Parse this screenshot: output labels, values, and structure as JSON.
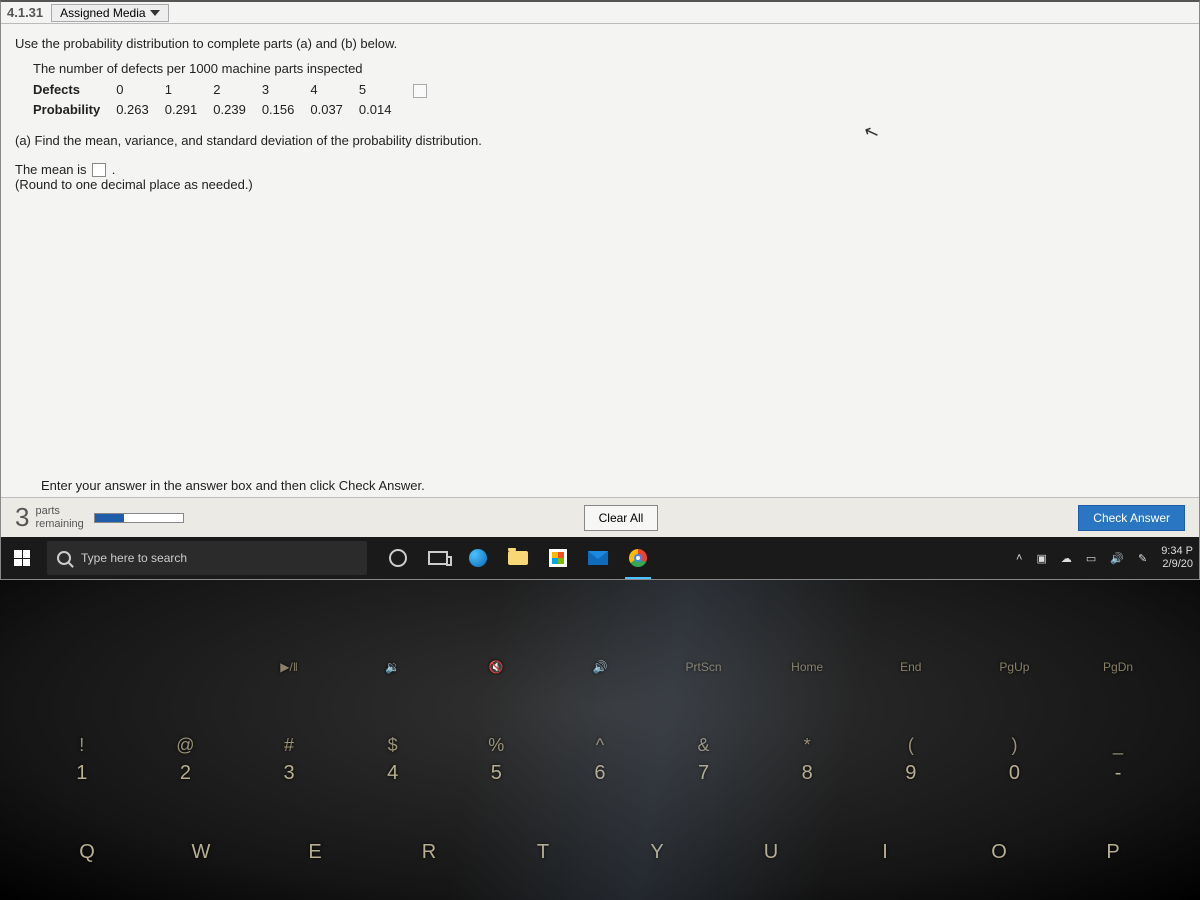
{
  "header": {
    "question_number": "4.1.31",
    "assigned_media": "Assigned Media"
  },
  "problem": {
    "prompt": "Use the probability distribution to complete parts (a) and (b) below.",
    "table_caption": "The number of defects per 1000 machine parts inspected",
    "row1_label": "Defects",
    "row2_label": "Probability",
    "defects": [
      "0",
      "1",
      "2",
      "3",
      "4",
      "5"
    ],
    "probs": [
      "0.263",
      "0.291",
      "0.239",
      "0.156",
      "0.037",
      "0.014"
    ],
    "part_a": "(a) Find the mean, variance, and standard deviation of the probability distribution.",
    "mean_pre": "The mean is ",
    "mean_post": ".",
    "round_note": "(Round to one decimal place as needed.)"
  },
  "footer": {
    "hint": "Enter your answer in the answer box and then click Check Answer.",
    "parts_count": "3",
    "parts_label1": "parts",
    "parts_label2": "remaining",
    "clear_all": "Clear All",
    "check_answer": "Check Answer"
  },
  "taskbar": {
    "search_placeholder": "Type here to search",
    "time": "9:34 P",
    "date": "2/9/20"
  },
  "keyboard": {
    "fn_row": [
      "",
      "",
      "▶/‖",
      "🔉",
      "🔇",
      "🔊",
      "PrtScn",
      "Home",
      "End",
      "PgUp",
      "PgDn"
    ],
    "num_row_upper": [
      "!",
      "@",
      "#",
      "$",
      "%",
      "^",
      "&",
      "*",
      "(",
      ")",
      "_"
    ],
    "num_row_lower": [
      "1",
      "2",
      "3",
      "4",
      "5",
      "6",
      "7",
      "8",
      "9",
      "0",
      "-"
    ],
    "letter_row": [
      "Q",
      "W",
      "E",
      "R",
      "T",
      "Y",
      "U",
      "I",
      "O",
      "P"
    ]
  }
}
